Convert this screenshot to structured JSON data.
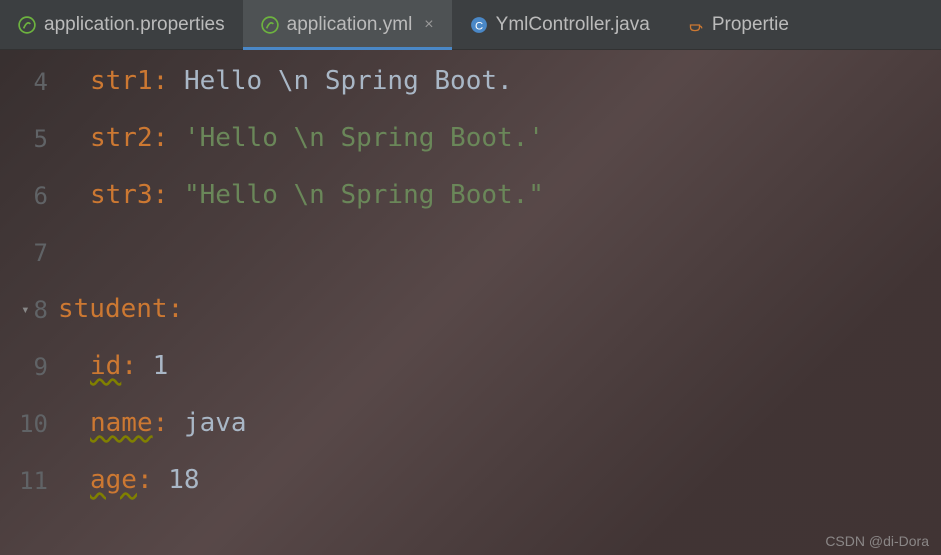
{
  "tabs": [
    {
      "label": "application.properties",
      "icon": "spring",
      "active": false
    },
    {
      "label": "application.yml",
      "icon": "spring",
      "active": true
    },
    {
      "label": "YmlController.java",
      "icon": "class",
      "active": false
    },
    {
      "label": "Propertie",
      "icon": "java",
      "active": false,
      "truncated": true
    }
  ],
  "lines": [
    {
      "num": "4",
      "indent": 1,
      "key": "str1",
      "key_style": "plain",
      "value_prefix": "Hello \\n Spring Boot.",
      "value_type": "plain"
    },
    {
      "num": "5",
      "indent": 1,
      "key": "str2",
      "key_style": "plain",
      "value_prefix": "'Hello \\n Spring Boot.'",
      "value_type": "single"
    },
    {
      "num": "6",
      "indent": 1,
      "key": "str3",
      "key_style": "plain",
      "value_prefix": "\"Hello \\n Spring Boot.\"",
      "value_type": "double"
    },
    {
      "num": "7",
      "blank": true
    },
    {
      "num": "8",
      "indent": 0,
      "key": "student",
      "key_style": "plain",
      "fold": true,
      "no_value": true
    },
    {
      "num": "9",
      "indent": 1,
      "key": "id",
      "key_style": "underline",
      "value_prefix": "1",
      "value_type": "plain"
    },
    {
      "num": "10",
      "indent": 1,
      "key": "name",
      "key_style": "underline",
      "value_prefix": "java",
      "value_type": "plain"
    },
    {
      "num": "11",
      "indent": 1,
      "key": "age",
      "key_style": "underline",
      "value_prefix": "18",
      "value_type": "plain"
    }
  ],
  "watermark": "CSDN @di-Dora",
  "close_glyph": "×"
}
